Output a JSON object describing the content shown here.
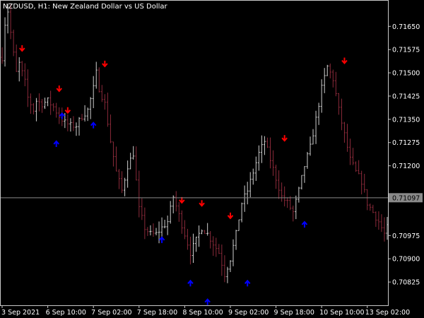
{
  "chart_data": {
    "type": "bar",
    "title": "NZDUSD, H1:  New Zealand Dollar vs US Dollar",
    "symbol": "NZDUSD",
    "timeframe": "H1",
    "subtitle": "New Zealand Dollar vs US Dollar",
    "ylim": [
      0.7075,
      0.71735
    ],
    "yticks": [
      "0.71650",
      "0.71575",
      "0.71500",
      "0.71425",
      "0.71350",
      "0.71275",
      "0.71200",
      "0.71097",
      "0.70975",
      "0.70900",
      "0.70825"
    ],
    "ytick_values": [
      0.7165,
      0.71575,
      0.715,
      0.71425,
      0.7135,
      0.71275,
      0.712,
      0.70975,
      0.709,
      0.70825
    ],
    "xticks": [
      "3 Sep 2021",
      "6 Sep 10:00",
      "7 Sep 02:00",
      "7 Sep 18:00",
      "8 Sep 10:00",
      "9 Sep 02:00",
      "9 Sep 18:00",
      "10 Sep 10:00",
      "13 Sep 02:00"
    ],
    "xtick_bars": [
      0,
      16,
      32,
      48,
      64,
      80,
      96,
      112,
      128
    ],
    "current_price": 0.71097,
    "current_price_label": "0.71097",
    "bar_count": 136,
    "anchors": [
      [
        0,
        0.7155
      ],
      [
        1,
        0.7166
      ],
      [
        2,
        0.717
      ],
      [
        3,
        0.7163
      ],
      [
        4,
        0.7156
      ],
      [
        5,
        0.715
      ],
      [
        6,
        0.7153
      ],
      [
        7,
        0.715
      ],
      [
        8,
        0.7147
      ],
      [
        9,
        0.7142
      ],
      [
        10,
        0.714
      ],
      [
        11,
        0.7138
      ],
      [
        12,
        0.7141
      ],
      [
        14,
        0.714
      ],
      [
        16,
        0.7141
      ],
      [
        18,
        0.7139
      ],
      [
        20,
        0.7136
      ],
      [
        22,
        0.7134
      ],
      [
        24,
        0.7133
      ],
      [
        26,
        0.7133
      ],
      [
        28,
        0.7136
      ],
      [
        30,
        0.7138
      ],
      [
        32,
        0.7145
      ],
      [
        33,
        0.715
      ],
      [
        34,
        0.7145
      ],
      [
        36,
        0.714
      ],
      [
        38,
        0.7128
      ],
      [
        40,
        0.7118
      ],
      [
        42,
        0.7112
      ],
      [
        44,
        0.712
      ],
      [
        46,
        0.7124
      ],
      [
        48,
        0.7106
      ],
      [
        50,
        0.71
      ],
      [
        52,
        0.7098
      ],
      [
        54,
        0.7098
      ],
      [
        56,
        0.71
      ],
      [
        58,
        0.7102
      ],
      [
        60,
        0.711
      ],
      [
        62,
        0.7104
      ],
      [
        64,
        0.7098
      ],
      [
        66,
        0.7092
      ],
      [
        68,
        0.7096
      ],
      [
        70,
        0.71
      ],
      [
        72,
        0.7098
      ],
      [
        74,
        0.7095
      ],
      [
        76,
        0.7092
      ],
      [
        78,
        0.7085
      ],
      [
        80,
        0.709
      ],
      [
        82,
        0.7098
      ],
      [
        84,
        0.7108
      ],
      [
        86,
        0.7112
      ],
      [
        88,
        0.7118
      ],
      [
        90,
        0.7124
      ],
      [
        92,
        0.7128
      ],
      [
        94,
        0.7122
      ],
      [
        96,
        0.7116
      ],
      [
        98,
        0.711
      ],
      [
        100,
        0.7108
      ],
      [
        102,
        0.7105
      ],
      [
        104,
        0.7112
      ],
      [
        106,
        0.712
      ],
      [
        108,
        0.7126
      ],
      [
        110,
        0.7135
      ],
      [
        112,
        0.7145
      ],
      [
        114,
        0.7152
      ],
      [
        116,
        0.7148
      ],
      [
        118,
        0.7138
      ],
      [
        120,
        0.713
      ],
      [
        122,
        0.7122
      ],
      [
        124,
        0.7118
      ],
      [
        126,
        0.7115
      ],
      [
        128,
        0.7108
      ],
      [
        130,
        0.7105
      ],
      [
        132,
        0.7102
      ],
      [
        134,
        0.7098
      ],
      [
        135,
        0.71
      ]
    ],
    "sell_arrows": [
      7,
      20,
      23,
      36,
      63,
      70,
      80,
      99,
      120
    ],
    "sell_arrow_prices": [
      0.7158,
      0.7145,
      0.7138,
      0.7153,
      0.7109,
      0.7108,
      0.7104,
      0.7129,
      0.7154
    ],
    "buy_arrows": [
      19,
      21,
      32,
      56,
      66,
      72,
      86,
      106
    ],
    "buy_arrow_prices": [
      0.7127,
      0.7136,
      0.7133,
      0.7096,
      0.7082,
      0.7076,
      0.7082,
      0.7101
    ],
    "colors": {
      "background": "#000000",
      "frame": "#c8c8c8",
      "text": "#ffffff",
      "up_bar": "#cfcfcf",
      "down_bar": "#8b2a3a",
      "sell_arrow": "#ff0000",
      "buy_arrow": "#0000ff",
      "price_line": "#8a8a8a",
      "price_label_bg": "#8a8a8a"
    }
  }
}
